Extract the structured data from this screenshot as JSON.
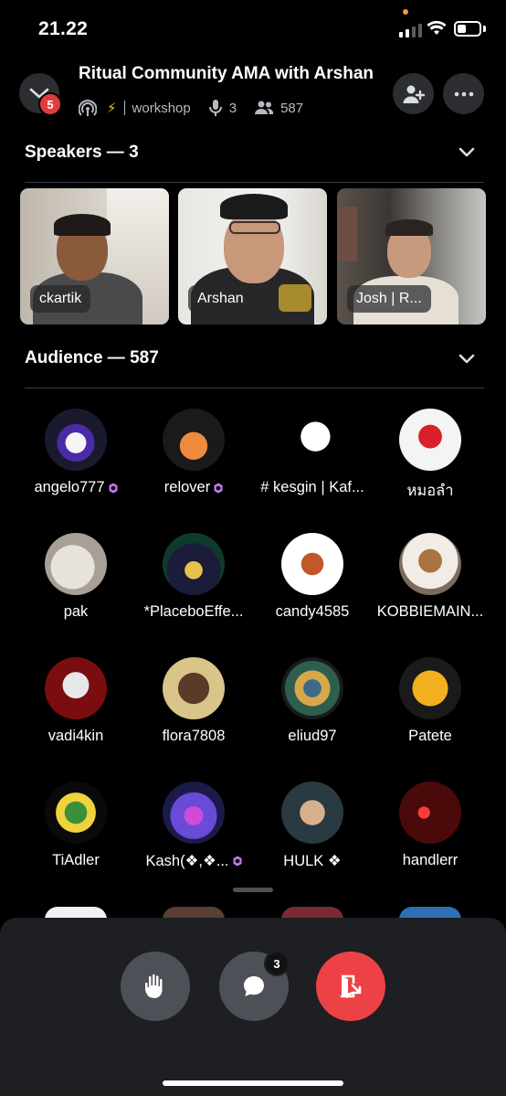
{
  "status_bar": {
    "time": "21.22"
  },
  "header": {
    "title": "Ritual Community AMA with Arshan",
    "notification_count": "5",
    "stage_emoji": "⚡",
    "channel": "workshop",
    "speaker_count": "3",
    "listener_count": "587"
  },
  "speakers_section": {
    "title": "Speakers — 3",
    "speakers": [
      {
        "name": "ckartik"
      },
      {
        "name": "Arshan"
      },
      {
        "name": "Josh | R..."
      }
    ]
  },
  "audience_section": {
    "title": "Audience — 587",
    "members": [
      {
        "name": "angelo777",
        "nitro": true
      },
      {
        "name": "relover",
        "nitro": true
      },
      {
        "name": "# kesgin | Kaf...",
        "nitro": false
      },
      {
        "name": "หมอลำ",
        "nitro": false
      },
      {
        "name": "pak",
        "nitro": false
      },
      {
        "name": "*PlaceboEffe...",
        "nitro": false
      },
      {
        "name": "candy4585",
        "nitro": false
      },
      {
        "name": "KOBBIEMAIN...",
        "nitro": false
      },
      {
        "name": "vadi4kin",
        "nitro": false
      },
      {
        "name": "flora7808",
        "nitro": false
      },
      {
        "name": "eliud97",
        "nitro": false
      },
      {
        "name": "Patete",
        "nitro": false
      },
      {
        "name": "TiAdler",
        "nitro": false
      },
      {
        "name": "Kash(❖,❖...",
        "nitro": true
      },
      {
        "name": "HULK ❖",
        "nitro": false
      },
      {
        "name": "handlerr",
        "nitro": false
      }
    ]
  },
  "controls": {
    "chat_unread": "3",
    "icons": [
      "raise-hand-icon",
      "chat-bubble-icon",
      "leave-stage-icon"
    ],
    "leave_color": "#ed4245"
  },
  "colors": {
    "background": "#000000",
    "sheet": "#1e1f22",
    "nitro": "#c37bf5",
    "badge": "#e03c3c"
  }
}
